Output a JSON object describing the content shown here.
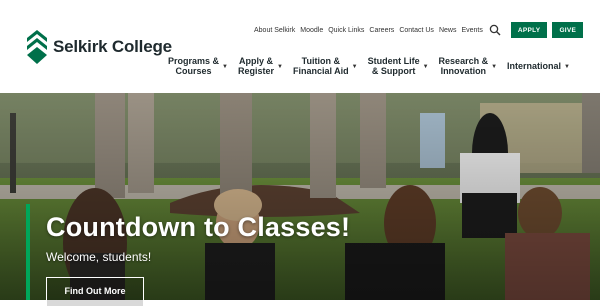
{
  "brand": {
    "name": "Selkirk College",
    "accent": "#00704a",
    "hero_accent": "#00a75a"
  },
  "utility_nav": {
    "links": [
      "About Selkirk",
      "Moodle",
      "Quick Links",
      "Careers",
      "Contact Us",
      "News",
      "Events"
    ],
    "search_icon": "search-icon",
    "apply_label": "APPLY",
    "give_label": "GIVE"
  },
  "main_nav": {
    "items": [
      {
        "label": "Programs &\nCourses"
      },
      {
        "label": "Apply &\nRegister"
      },
      {
        "label": "Tuition &\nFinancial Aid"
      },
      {
        "label": "Student Life\n& Support"
      },
      {
        "label": "Research &\nInnovation"
      },
      {
        "label": "International"
      }
    ],
    "caret_icon": "chevron-down-icon"
  },
  "hero": {
    "title": "Countdown to Classes!",
    "subtitle": "Welcome, students!",
    "cta_label": "Find Out More"
  }
}
